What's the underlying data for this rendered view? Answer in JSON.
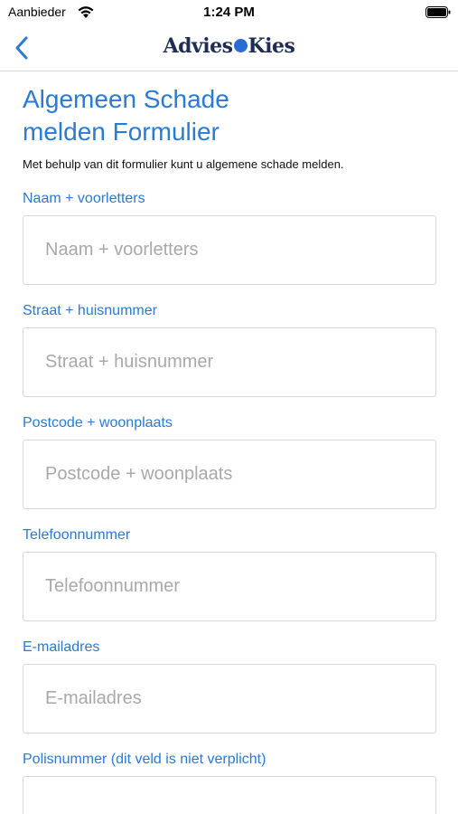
{
  "status_bar": {
    "carrier": "Aanbieder",
    "time": "1:24 PM"
  },
  "nav": {
    "logo_left": "Advies",
    "logo_right": "Kies"
  },
  "form": {
    "title_line1": "Algemeen Schade",
    "title_line2": "melden Formulier",
    "intro": "Met behulp van dit formulier kunt u algemene schade melden.",
    "fields": [
      {
        "label": "Naam + voorletters",
        "placeholder": "Naam + voorletters",
        "value": ""
      },
      {
        "label": "Straat + huisnummer",
        "placeholder": "Straat + huisnummer",
        "value": ""
      },
      {
        "label": "Postcode + woonplaats",
        "placeholder": "Postcode + woonplaats",
        "value": ""
      },
      {
        "label": "Telefoonnummer",
        "placeholder": "Telefoonnummer",
        "value": ""
      },
      {
        "label": "E-mailadres",
        "placeholder": "E-mailadres",
        "value": ""
      },
      {
        "label": "Polisnummer (dit veld is niet verplicht)",
        "placeholder": "",
        "value": ""
      }
    ]
  },
  "colors": {
    "accent": "#2a7ad6",
    "logo": "#1f2d55",
    "logo_dot": "#2b6cd4",
    "input_border": "#d7d7d7",
    "placeholder": "#a9a9a9"
  },
  "icons": {
    "back": "chevron-left-icon",
    "wifi": "wifi-icon",
    "battery": "battery-icon"
  }
}
